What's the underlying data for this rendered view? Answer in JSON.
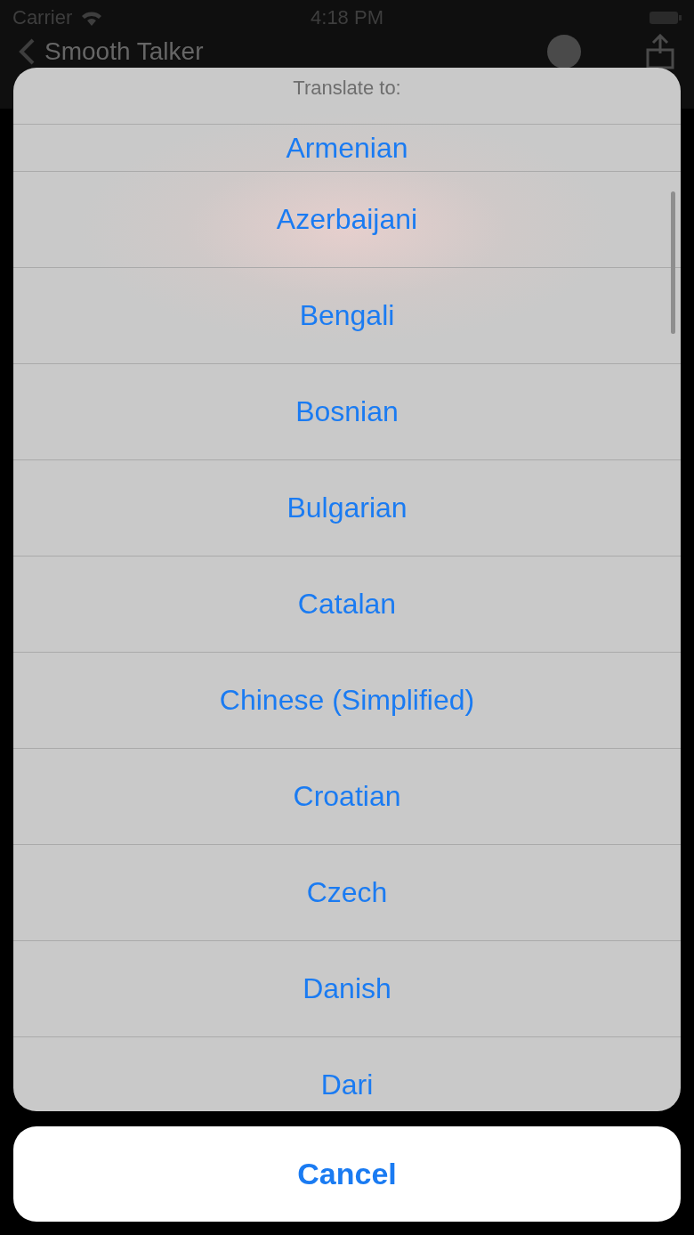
{
  "status_bar": {
    "carrier": "Carrier",
    "time": "4:18 PM"
  },
  "nav_bar": {
    "title": "Smooth Talker"
  },
  "action_sheet": {
    "title": "Translate to:",
    "options": [
      "Armenian",
      "Azerbaijani",
      "Bengali",
      "Bosnian",
      "Bulgarian",
      "Catalan",
      "Chinese (Simplified)",
      "Croatian",
      "Czech",
      "Danish",
      "Dari"
    ],
    "cancel": "Cancel"
  }
}
